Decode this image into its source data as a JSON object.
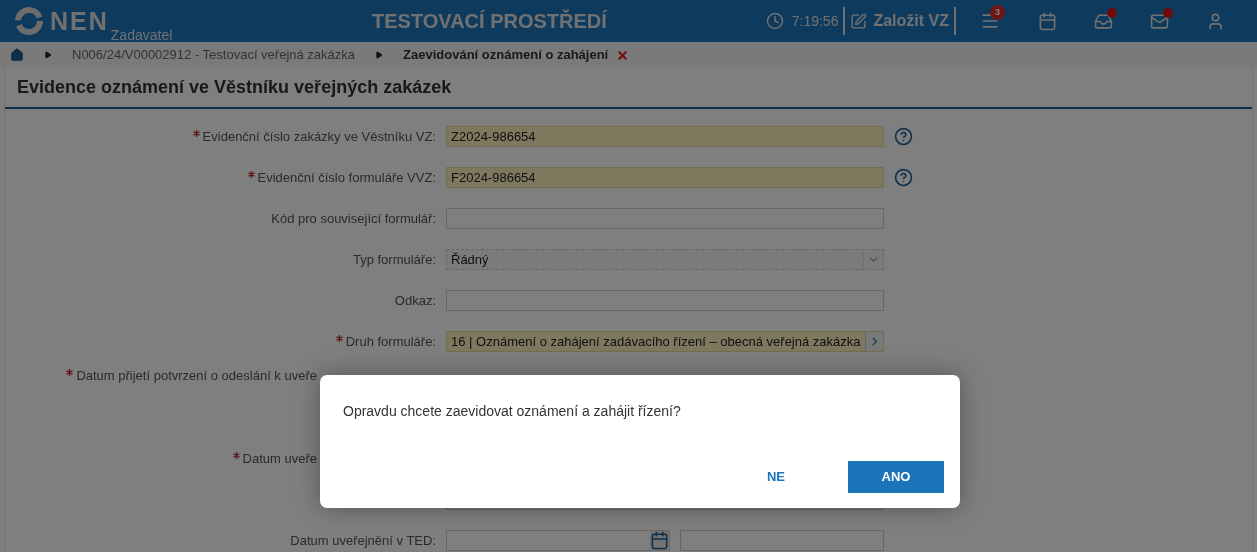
{
  "header": {
    "logo": "NEN",
    "subtitle": "Zadavatel",
    "environment": "TESTOVACÍ PROSTŘEDÍ",
    "time": "7:19:56",
    "create_button": "Založit VZ",
    "tasks_badge": "3",
    "inbox_notification": true,
    "mail_notification": true
  },
  "breadcrumb": [
    {
      "label": "N006/24/V00002912 - Testovací veřejná zakázka",
      "current": false
    },
    {
      "label": "Zaevidování oznámení o zahájení",
      "current": true
    }
  ],
  "page_title": "Evidence oznámení ve Věstníku veřejných zakázek",
  "form": {
    "fields": [
      {
        "kind": "text",
        "label": "Evidenční číslo zakázky ve Věstníku VZ:",
        "required": true,
        "value": "Z2024-986654",
        "highlighted": true,
        "help": true
      },
      {
        "kind": "text",
        "label": "Evidenční číslo formuláře VVZ:",
        "required": true,
        "value": "F2024-986654",
        "highlighted": true,
        "help": true
      },
      {
        "kind": "text",
        "label": "Kód pro související formulář:",
        "highlighted": false
      },
      {
        "kind": "select",
        "label": "Typ formuláře:",
        "value": "Řádný",
        "highlighted": false
      },
      {
        "kind": "text",
        "label": "Odkaz:",
        "highlighted": false
      },
      {
        "kind": "picker",
        "label": "Druh formuláře:",
        "required": true,
        "value": "16 | Oznámení o zahájení zadávacího řízení – obecná veřejná zakázka",
        "highlighted": true
      },
      {
        "kind": "covered_long",
        "label": "Datum přijetí potvrzení o odeslání k uveře",
        "required": true
      },
      {
        "kind": "covered",
        "label": "Datum uveře",
        "required": true
      },
      {
        "kind": "text",
        "highlighted": false
      },
      {
        "kind": "date",
        "label": "Datum uveřejnění v TED:",
        "highlighted": false
      }
    ]
  },
  "dialog": {
    "message": "Opravdu chcete zaevidovat oznámení a zahájit řízení?",
    "buttons": [
      {
        "label": "NE",
        "primary": false
      },
      {
        "label": "ANO",
        "primary": true
      }
    ]
  }
}
